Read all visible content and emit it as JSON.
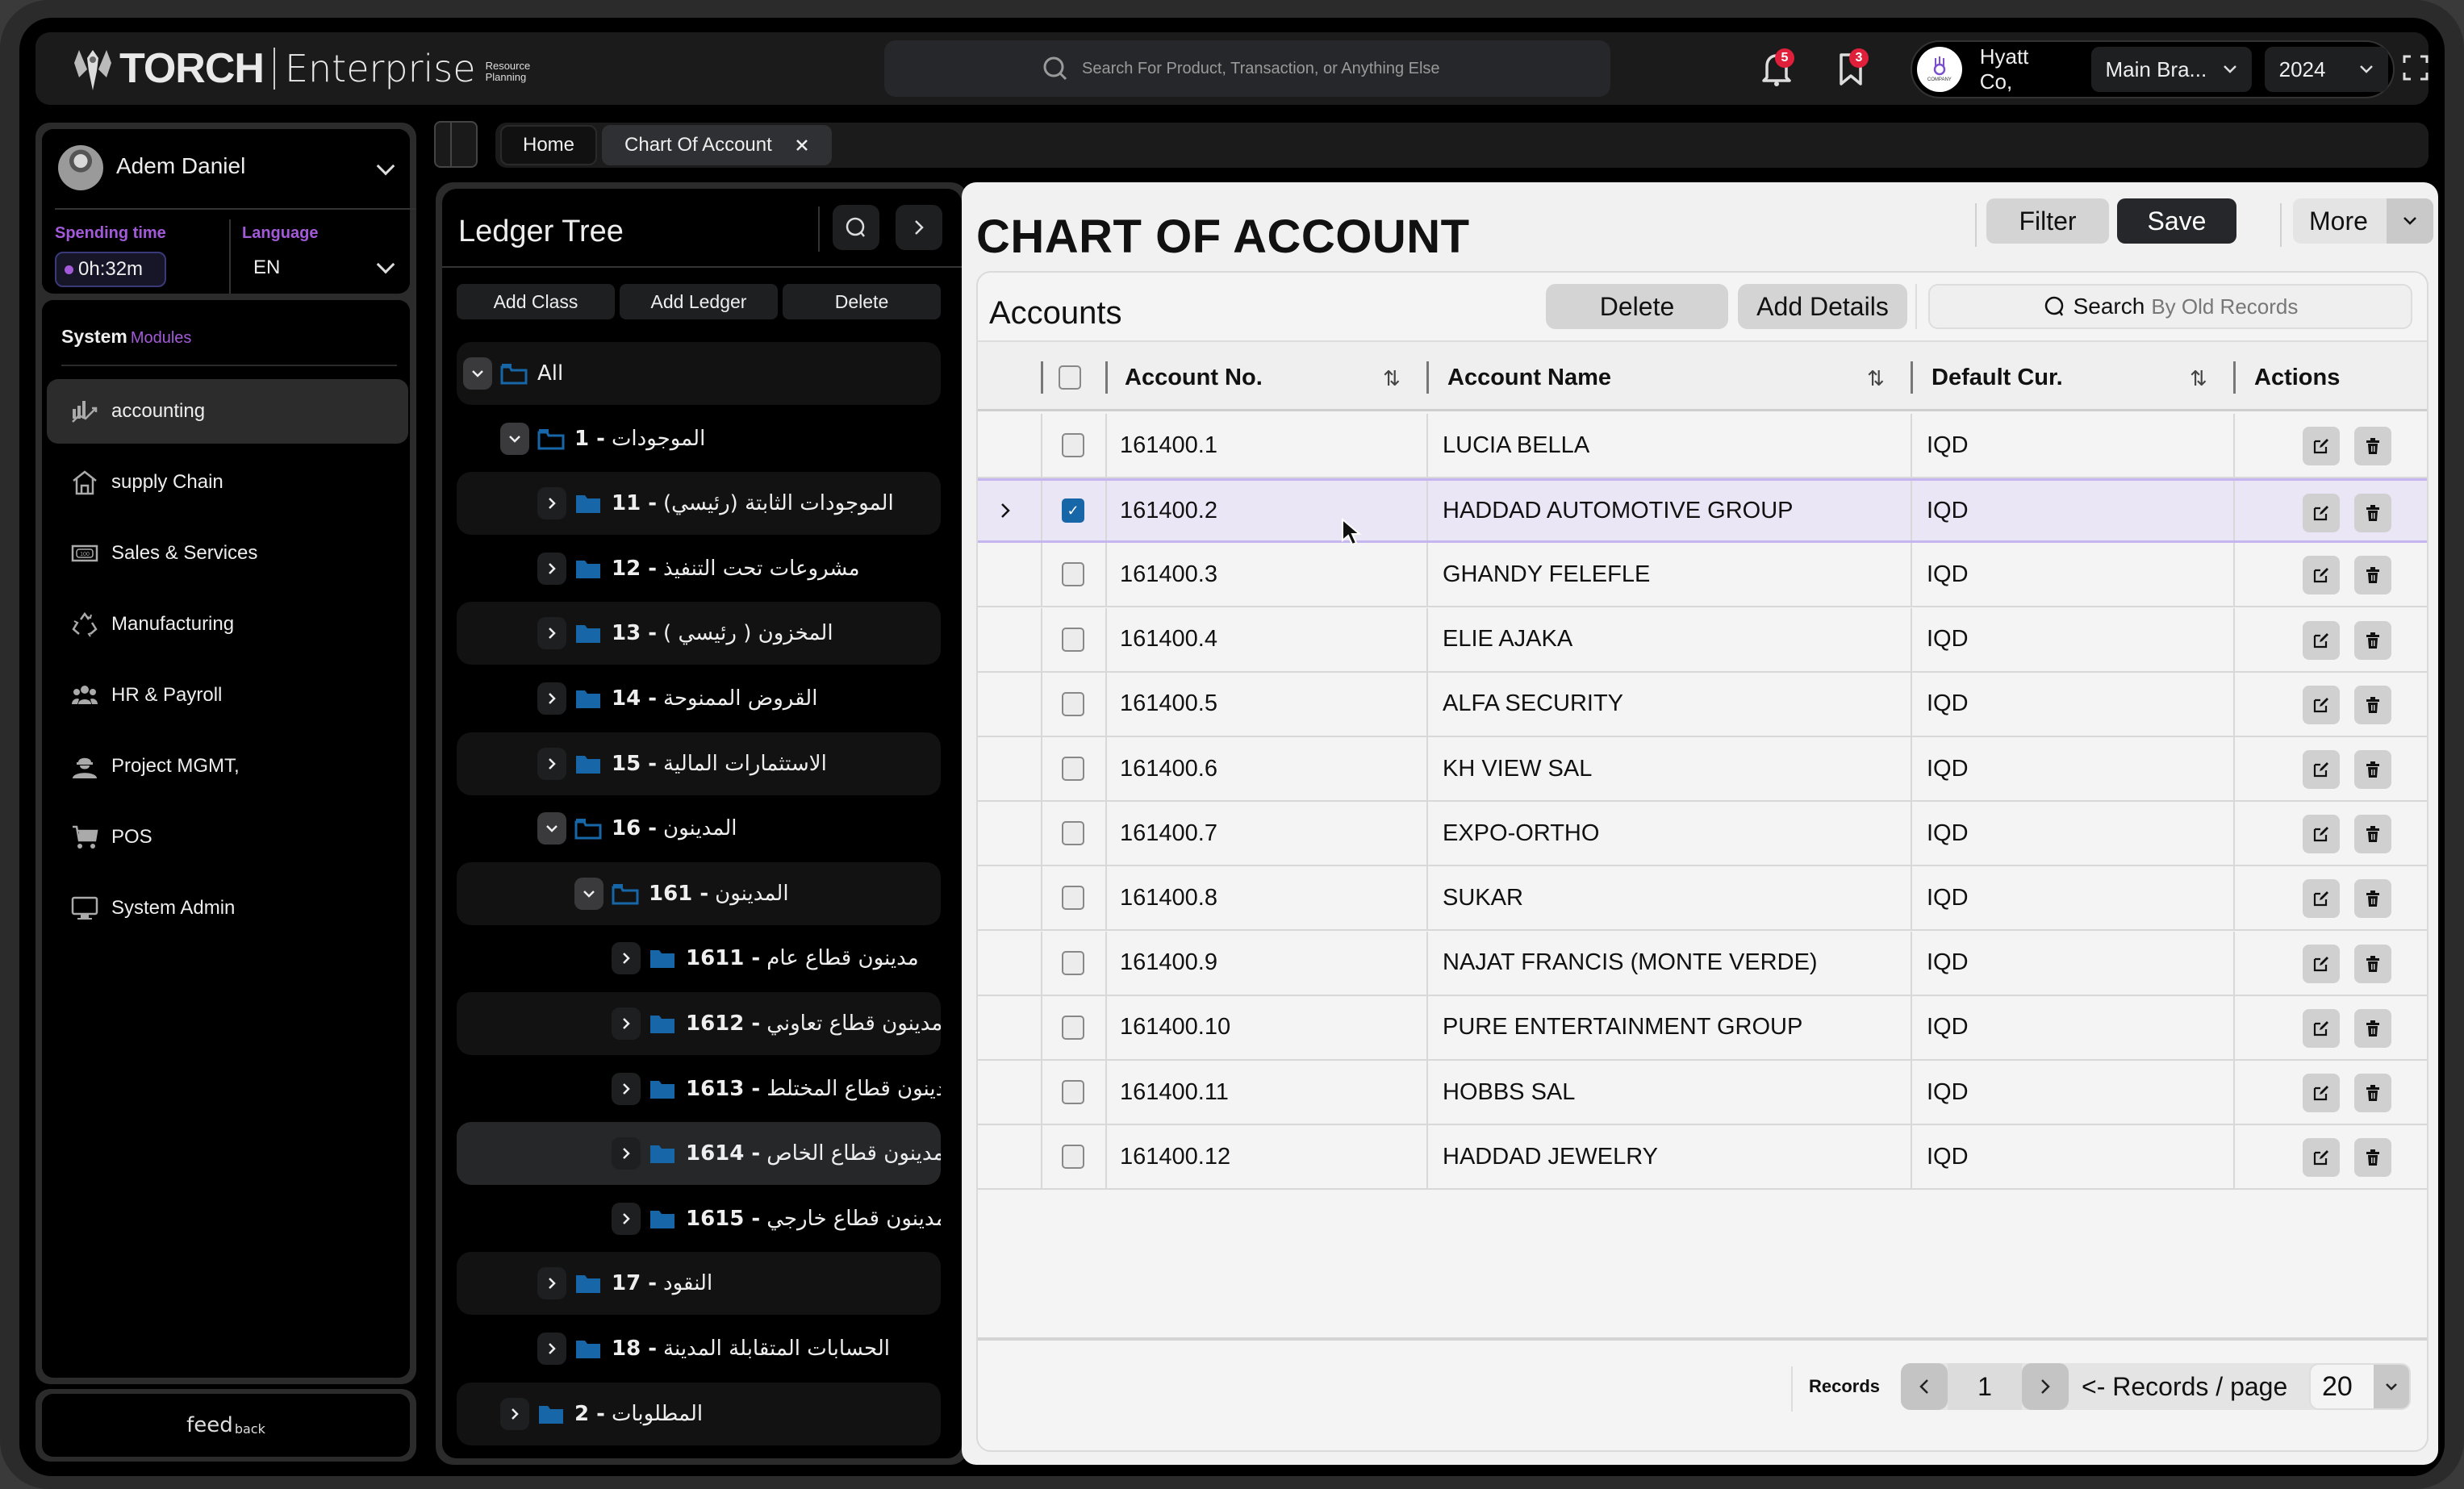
{
  "app": {
    "brand": "TORCH",
    "product": "Enterprise",
    "tagline_line1": "Resource",
    "tagline_line2": "Planning"
  },
  "header": {
    "search_placeholder": "Search For Product, Transaction, or Anything Else",
    "notifications_count": "5",
    "bookmarks_count": "3",
    "company_logo_text": "COMPANY",
    "company_name": "Hyatt Co,",
    "branch": "Main Bra...",
    "year": "2024"
  },
  "sidebar": {
    "user_name": "Adem Daniel",
    "spending_time_label": "Spending time",
    "spending_time_value": "0h:32m",
    "language_label": "Language",
    "language_value": "EN",
    "modules_title": "System",
    "modules_subtitle": "Modules",
    "items": [
      {
        "label": "accounting",
        "icon": "chart-icon",
        "active": true
      },
      {
        "label": "supply Chain",
        "icon": "warehouse-icon",
        "active": false
      },
      {
        "label": "Sales & Services",
        "icon": "banknote-icon",
        "active": false
      },
      {
        "label": "Manufacturing",
        "icon": "recycle-icon",
        "active": false
      },
      {
        "label": "HR & Payroll",
        "icon": "people-icon",
        "active": false
      },
      {
        "label": "Project MGMT,",
        "icon": "worker-icon",
        "active": false
      },
      {
        "label": "POS",
        "icon": "cart-icon",
        "active": false
      },
      {
        "label": "System Admin",
        "icon": "monitor-icon",
        "active": false
      }
    ],
    "feedback_main": "feed",
    "feedback_small": "back"
  },
  "tabs": [
    {
      "label": "Home",
      "active": false
    },
    {
      "label": "Chart Of Account",
      "active": true,
      "closable": true
    }
  ],
  "ledger": {
    "title": "Ledger Tree",
    "buttons": {
      "add_class": "Add Class",
      "add_ledger": "Add Ledger",
      "delete": "Delete"
    },
    "nodes": [
      {
        "code": "",
        "name": "All",
        "level": 0,
        "expanded": true
      },
      {
        "code": "1",
        "name": "الموجودات",
        "level": 1,
        "expanded": true
      },
      {
        "code": "11",
        "name": "الموجودات الثابتة (رئيسي)",
        "level": 2,
        "expanded": false
      },
      {
        "code": "12",
        "name": "مشروعات تحت التنفيذ",
        "level": 2,
        "expanded": false
      },
      {
        "code": "13",
        "name": "المخزون ( رئيسي )",
        "level": 2,
        "expanded": false
      },
      {
        "code": "14",
        "name": "القروض الممنوحة",
        "level": 2,
        "expanded": false
      },
      {
        "code": "15",
        "name": "الاستثمارات المالية",
        "level": 2,
        "expanded": false
      },
      {
        "code": "16",
        "name": "المدينون",
        "level": 2,
        "expanded": true
      },
      {
        "code": "161",
        "name": "المدينون",
        "level": 3,
        "expanded": true
      },
      {
        "code": "1611",
        "name": "مدينون قطاع عام",
        "level": 4,
        "expanded": false
      },
      {
        "code": "1612",
        "name": "مدينون قطاع تعاوني",
        "level": 4,
        "expanded": false
      },
      {
        "code": "1613",
        "name": "مدينون قطاع المختلط",
        "level": 4,
        "expanded": false
      },
      {
        "code": "1614",
        "name": "مدينون قطاع الخاص",
        "level": 4,
        "expanded": false,
        "highlighted": true
      },
      {
        "code": "1615",
        "name": "مدينون قطاع خارجي",
        "level": 4,
        "expanded": false
      },
      {
        "code": "17",
        "name": "النقود",
        "level": 2,
        "expanded": false
      },
      {
        "code": "18",
        "name": "الحسابات المتقابلة المدينة",
        "level": 2,
        "expanded": false
      },
      {
        "code": "2",
        "name": "المطلوبات",
        "level": 1,
        "expanded": false
      }
    ]
  },
  "main": {
    "title": "CHART OF ACCOUNT",
    "filter_label": "Filter",
    "save_label": "Save",
    "more_label": "More",
    "card_title": "Accounts",
    "delete_label": "Delete",
    "add_details_label": "Add Details",
    "search_label": "Search",
    "search_hint": "By Old Records",
    "columns": [
      "Account No.",
      "Account Name",
      "Default Cur.",
      "Actions"
    ],
    "rows": [
      {
        "no": "161400.1",
        "name": "LUCIA BELLA",
        "cur": "IQD",
        "selected": false
      },
      {
        "no": "161400.2",
        "name": "HADDAD AUTOMOTIVE GROUP",
        "cur": "IQD",
        "selected": true
      },
      {
        "no": "161400.3",
        "name": "GHANDY FELEFLE",
        "cur": "IQD",
        "selected": false
      },
      {
        "no": "161400.4",
        "name": "ELIE AJAKA",
        "cur": "IQD",
        "selected": false
      },
      {
        "no": "161400.5",
        "name": "ALFA SECURITY",
        "cur": "IQD",
        "selected": false
      },
      {
        "no": "161400.6",
        "name": "KH VIEW SAL",
        "cur": "IQD",
        "selected": false
      },
      {
        "no": "161400.7",
        "name": "EXPO-ORTHO",
        "cur": "IQD",
        "selected": false
      },
      {
        "no": "161400.8",
        "name": "SUKAR",
        "cur": "IQD",
        "selected": false
      },
      {
        "no": "161400.9",
        "name": "NAJAT FRANCIS (MONTE VERDE)",
        "cur": "IQD",
        "selected": false
      },
      {
        "no": "161400.10",
        "name": "PURE ENTERTAINMENT GROUP",
        "cur": "IQD",
        "selected": false
      },
      {
        "no": "161400.11",
        "name": "HOBBS SAL",
        "cur": "IQD",
        "selected": false
      },
      {
        "no": "161400.12",
        "name": "HADDAD JEWELRY",
        "cur": "IQD",
        "selected": false
      }
    ],
    "pagination": {
      "records_label": "Records",
      "page": "1",
      "per_page_label": "<- Records / page",
      "per_page": "20"
    }
  },
  "colors": {
    "accent_purple": "#a35ad8",
    "folder_blue": "#1766a8",
    "badge_red": "#e0203a",
    "selected_row": "#ebe6f5",
    "selected_row_border": "#c6b6f0"
  }
}
